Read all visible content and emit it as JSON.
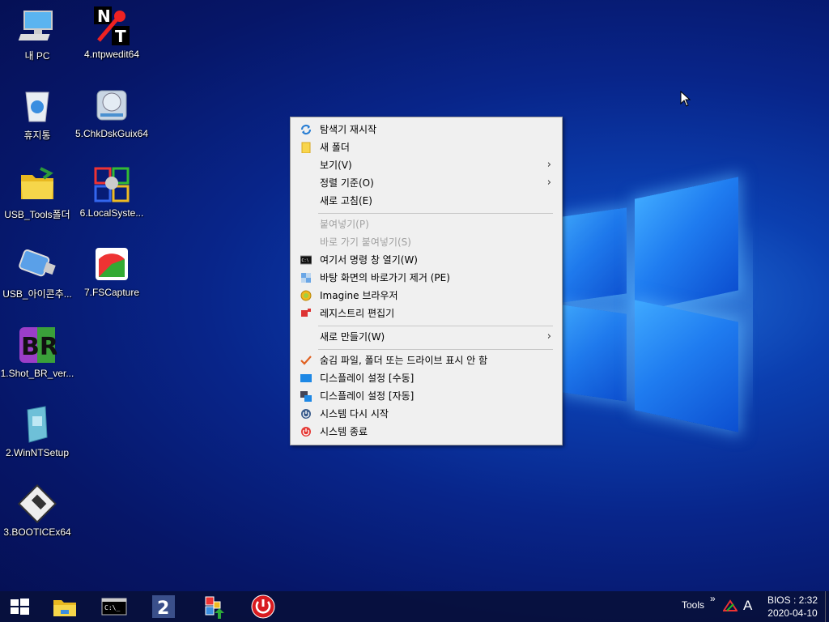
{
  "desktop_icons": [
    {
      "label": "내 PC",
      "icon": "computer-icon"
    },
    {
      "label": "4.ntpwedit64",
      "icon": "ntpwedit-icon"
    },
    {
      "label": "휴지통",
      "icon": "recycle-bin-icon"
    },
    {
      "label": "5.ChkDskGuix64",
      "icon": "disk-check-icon"
    },
    {
      "label": "USB_Tools폴더",
      "icon": "folder-icon"
    },
    {
      "label": "6.LocalSyste...",
      "icon": "local-system-icon"
    },
    {
      "label": "USB_아이콘추...",
      "icon": "usb-icon"
    },
    {
      "label": "7.FSCapture",
      "icon": "fscapture-icon"
    },
    {
      "label": "1.Shot_BR_ver...",
      "icon": "br-icon"
    },
    {
      "label": "2.WinNTSetup",
      "icon": "winntsetup-icon"
    },
    {
      "label": "3.BOOTICEx64",
      "icon": "bootice-icon"
    }
  ],
  "context_menu": {
    "items": [
      {
        "label": "탐색기 재시작",
        "icon": "refresh-icon"
      },
      {
        "label": "새 폴더",
        "icon": "folder-icon"
      },
      {
        "label": "보기(V)",
        "submenu": "›"
      },
      {
        "label": "정렬 기준(O)",
        "submenu": "›"
      },
      {
        "label": "새로 고침(E)"
      },
      {
        "label": "붙여넣기(P)",
        "disabled": true
      },
      {
        "label": "바로 가기 붙여넣기(S)",
        "disabled": true
      },
      {
        "label": "여기서 명령 창 열기(W)",
        "icon": "cmd-icon"
      },
      {
        "label": "바탕 화면의 바로가기 제거 (PE)",
        "icon": "shortcut-remove-icon"
      },
      {
        "label": "Imagine 브라우저",
        "icon": "imagine-icon"
      },
      {
        "label": "레지스트리 편집기",
        "icon": "registry-icon"
      },
      {
        "label": "새로 만들기(W)",
        "submenu": "›"
      },
      {
        "label": "숨김 파일, 폴더 또는 드라이브 표시 안 함",
        "icon": "checkmark-icon"
      },
      {
        "label": "디스플레이 설정 [수동]",
        "icon": "display-icon"
      },
      {
        "label": "디스플레이 설정 [자동]",
        "icon": "display-auto-icon"
      },
      {
        "label": "시스템 다시 시작",
        "icon": "restart-icon"
      },
      {
        "label": "시스템 종료",
        "icon": "shutdown-icon"
      }
    ]
  },
  "taskbar": {
    "buttons": [
      "start-icon",
      "explorer-icon",
      "cmd-icon",
      "2-icon",
      "installer-icon",
      "power-icon"
    ],
    "tools_label": "Tools",
    "tools_chevron": "»",
    "ime": "A",
    "clock_line1": "BIOS : 2:32",
    "clock_line2": "2020-04-10"
  },
  "colors": {
    "menu_bg": "#f0f0f0",
    "disabled_text": "#a0a0a0",
    "taskbar_bg": "#08103c"
  }
}
